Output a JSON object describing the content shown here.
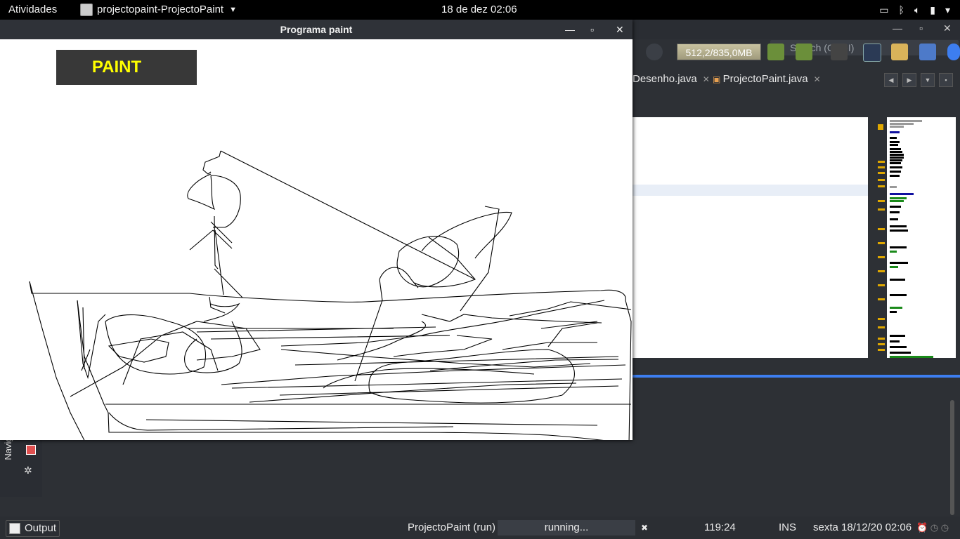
{
  "topbar": {
    "activities": "Atividades",
    "app_menu": "projectopaint-ProjectoPaint",
    "clock": "18 de dez  02:06"
  },
  "ide": {
    "search_placeholder": "Search (Ctrl+I)",
    "memory": "512,2/835,0MB",
    "tabs": [
      {
        "label": "Desenho.java"
      },
      {
        "label": "ProjectoPaint.java"
      }
    ],
    "navigator_label": "Navigator",
    "status": {
      "output_label": "Output",
      "run_label": "ProjectoPaint (run)",
      "run_state": "running...",
      "caret_pos": "119:24",
      "insert_mode": "INS",
      "datetime": "sexta 18/12/20 02:06"
    }
  },
  "paint": {
    "window_title": "Programa paint",
    "button_label": "PAINT",
    "button_text_color": "#ffff00",
    "button_bg": "#383838"
  },
  "colors": {
    "accent_progress": "#3d7ef0",
    "gutter_mark": "#e0a800"
  }
}
